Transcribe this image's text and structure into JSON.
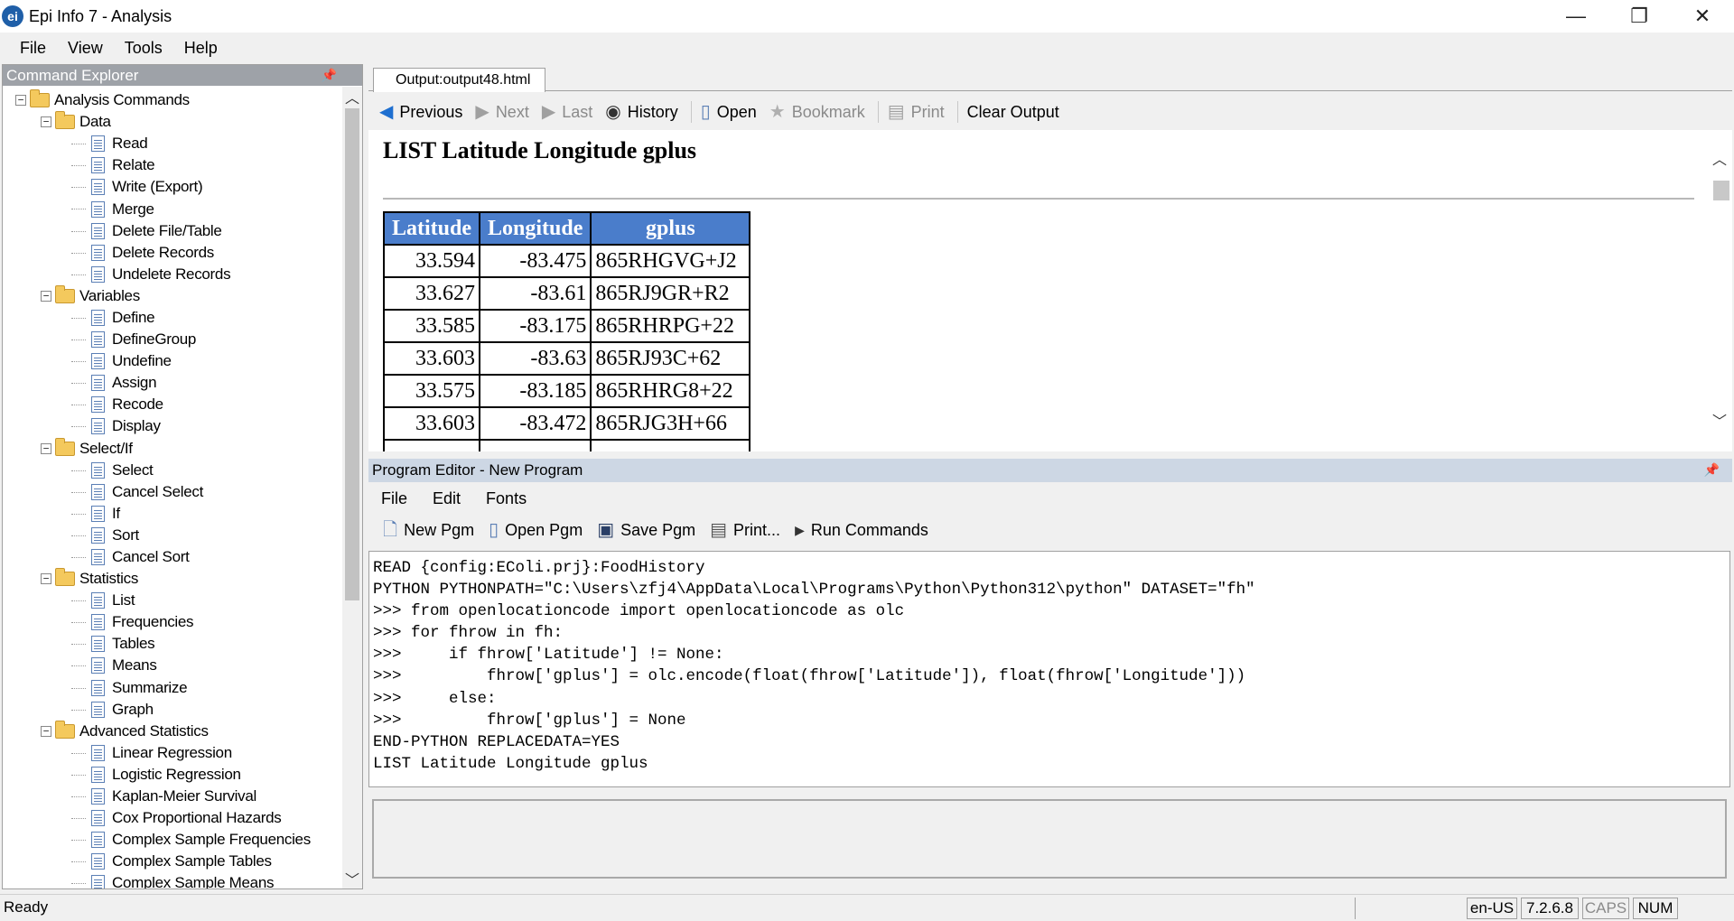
{
  "window": {
    "title": "Epi Info 7 - Analysis",
    "app_icon_text": "ei",
    "minimize": "—",
    "restore": "❐",
    "close": "✕"
  },
  "menubar": {
    "file": "File",
    "view": "View",
    "tools": "Tools",
    "help": "Help"
  },
  "explorer": {
    "title": "Command Explorer",
    "tree": [
      {
        "label": "Analysis Commands",
        "level": 0,
        "type": "folder",
        "expander": "−"
      },
      {
        "label": "Data",
        "level": 1,
        "type": "folder",
        "expander": "−"
      },
      {
        "label": "Read",
        "level": 2,
        "type": "doc"
      },
      {
        "label": "Relate",
        "level": 2,
        "type": "doc"
      },
      {
        "label": "Write (Export)",
        "level": 2,
        "type": "doc"
      },
      {
        "label": "Merge",
        "level": 2,
        "type": "doc"
      },
      {
        "label": "Delete File/Table",
        "level": 2,
        "type": "doc"
      },
      {
        "label": "Delete Records",
        "level": 2,
        "type": "doc"
      },
      {
        "label": "Undelete Records",
        "level": 2,
        "type": "doc"
      },
      {
        "label": "Variables",
        "level": 1,
        "type": "folder",
        "expander": "−"
      },
      {
        "label": "Define",
        "level": 2,
        "type": "doc"
      },
      {
        "label": "DefineGroup",
        "level": 2,
        "type": "doc"
      },
      {
        "label": "Undefine",
        "level": 2,
        "type": "doc"
      },
      {
        "label": "Assign",
        "level": 2,
        "type": "doc"
      },
      {
        "label": "Recode",
        "level": 2,
        "type": "doc"
      },
      {
        "label": "Display",
        "level": 2,
        "type": "doc"
      },
      {
        "label": "Select/If",
        "level": 1,
        "type": "folder",
        "expander": "−"
      },
      {
        "label": "Select",
        "level": 2,
        "type": "doc"
      },
      {
        "label": "Cancel Select",
        "level": 2,
        "type": "doc"
      },
      {
        "label": "If",
        "level": 2,
        "type": "doc"
      },
      {
        "label": "Sort",
        "level": 2,
        "type": "doc"
      },
      {
        "label": "Cancel Sort",
        "level": 2,
        "type": "doc"
      },
      {
        "label": "Statistics",
        "level": 1,
        "type": "folder",
        "expander": "−"
      },
      {
        "label": "List",
        "level": 2,
        "type": "doc"
      },
      {
        "label": "Frequencies",
        "level": 2,
        "type": "doc"
      },
      {
        "label": "Tables",
        "level": 2,
        "type": "doc"
      },
      {
        "label": "Means",
        "level": 2,
        "type": "doc"
      },
      {
        "label": "Summarize",
        "level": 2,
        "type": "doc"
      },
      {
        "label": "Graph",
        "level": 2,
        "type": "doc"
      },
      {
        "label": "Advanced Statistics",
        "level": 1,
        "type": "folder",
        "expander": "−"
      },
      {
        "label": "Linear Regression",
        "level": 2,
        "type": "doc"
      },
      {
        "label": "Logistic Regression",
        "level": 2,
        "type": "doc"
      },
      {
        "label": "Kaplan-Meier Survival",
        "level": 2,
        "type": "doc"
      },
      {
        "label": "Cox Proportional Hazards",
        "level": 2,
        "type": "doc"
      },
      {
        "label": "Complex Sample Frequencies",
        "level": 2,
        "type": "doc"
      },
      {
        "label": "Complex Sample Tables",
        "level": 2,
        "type": "doc"
      },
      {
        "label": "Complex Sample Means",
        "level": 2,
        "type": "doc"
      }
    ]
  },
  "output": {
    "tab_label": "Output:output48.html",
    "toolbar": {
      "previous": "Previous",
      "next": "Next",
      "last": "Last",
      "history": "History",
      "open": "Open",
      "bookmark": "Bookmark",
      "print": "Print",
      "clear": "Clear Output"
    },
    "heading": "LIST Latitude Longitude gplus",
    "table": {
      "headers": [
        "Latitude",
        "Longitude",
        "gplus"
      ],
      "rows": [
        [
          "33.594",
          "-83.475",
          "865RHGVG+J2"
        ],
        [
          "33.627",
          "-83.61",
          "865RJ9GR+R2"
        ],
        [
          "33.585",
          "-83.175",
          "865RHRPG+22"
        ],
        [
          "33.603",
          "-83.63",
          "865RJ93C+62"
        ],
        [
          "33.575",
          "-83.185",
          "865RHRG8+22"
        ],
        [
          "33.603",
          "-83.472",
          "865RJG3H+66"
        ]
      ]
    }
  },
  "program_editor": {
    "title": "Program Editor - New Program",
    "menu": {
      "file": "File",
      "edit": "Edit",
      "fonts": "Fonts"
    },
    "toolbar": {
      "new": "New Pgm",
      "open": "Open Pgm",
      "save": "Save Pgm",
      "print": "Print...",
      "run": "Run Commands"
    },
    "code": [
      "READ {config:EColi.prj}:FoodHistory",
      "PYTHON PYTHONPATH=\"C:\\Users\\zfj4\\AppData\\Local\\Programs\\Python\\Python312\\python\" DATASET=\"fh\"",
      ">>> from openlocationcode import openlocationcode as olc",
      ">>> for fhrow in fh:",
      ">>>     if fhrow['Latitude'] != None:",
      ">>>         fhrow['gplus'] = olc.encode(float(fhrow['Latitude']), float(fhrow['Longitude']))",
      ">>>     else:",
      ">>>         fhrow['gplus'] = None",
      "END-PYTHON REPLACEDATA=YES",
      "LIST Latitude Longitude gplus"
    ]
  },
  "statusbar": {
    "status": "Ready",
    "locale": "en-US",
    "version": "7.2.6.8",
    "caps": "CAPS",
    "num": "NUM"
  }
}
